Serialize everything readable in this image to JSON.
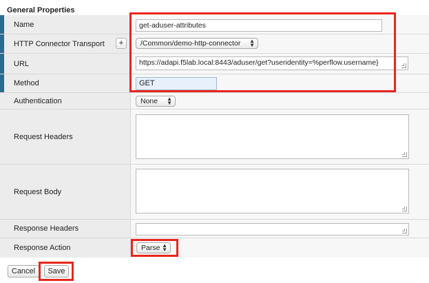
{
  "section": {
    "title": "General Properties"
  },
  "fields": {
    "name": {
      "label": "Name",
      "value": "get-aduser-attributes"
    },
    "transport": {
      "label": "HTTP Connector Transport",
      "add_label": "+",
      "selected": "/Common/demo-http-connector"
    },
    "url": {
      "label": "URL",
      "value": "https://adapi.f5lab.local:8443/aduser/get?useridentity=%perflow.username}"
    },
    "method": {
      "label": "Method",
      "value": "GET"
    },
    "authentication": {
      "label": "Authentication",
      "selected": "None"
    },
    "request_headers": {
      "label": "Request Headers",
      "value": ""
    },
    "request_body": {
      "label": "Request Body",
      "value": ""
    },
    "response_headers": {
      "label": "Response Headers",
      "value": ""
    },
    "response_action": {
      "label": "Response Action",
      "selected": "Parse"
    }
  },
  "buttons": {
    "cancel": "Cancel",
    "save": "Save"
  },
  "colors": {
    "required_marker": "#2e6a8e",
    "highlight": "#e8251f",
    "label_bg": "#ececec",
    "method_bg": "#e7f0fb"
  },
  "icons": {
    "select_arrows": "up-down-arrows-icon",
    "resize": "resize-handle-icon"
  }
}
